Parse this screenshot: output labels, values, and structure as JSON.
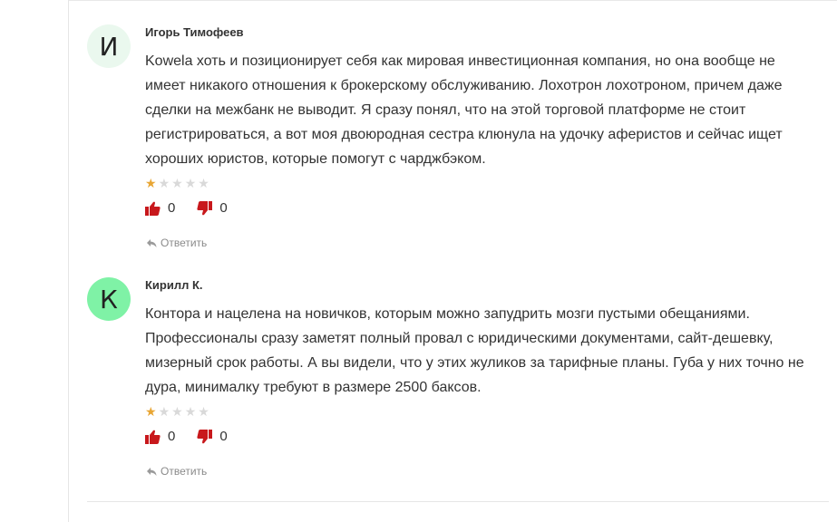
{
  "colors": {
    "avatar_bg_1": "#eaf8ee",
    "avatar_bg_2": "#7ff2a6",
    "star_on": "#e8a634",
    "star_off": "#d9d9d9",
    "thumb": "#c8181c"
  },
  "comments": [
    {
      "avatar_letter": "И",
      "author": "Игорь Тимофеев",
      "text": "Kowela хоть и позиционирует себя как мировая инвестиционная компания, но она вообще не имеет никакого отношения к брокерскому обслуживанию. Лохотрон лохотроном, причем даже сделки на межбанк не выводит. Я сразу понял, что на этой торговой платформе не стоит регистрироваться, а вот моя двоюродная сестра клюнула на удочку аферистов и сейчас ищет хороших юристов, которые помогут с чарджбэком.",
      "rating": 1,
      "rating_max": 5,
      "likes": "0",
      "dislikes": "0",
      "reply_label": "Ответить"
    },
    {
      "avatar_letter": "К",
      "author": "Кирилл К.",
      "text": "Контора и нацелена на новичков, которым можно запудрить мозги пустыми обещаниями. Профессионалы сразу заметят полный провал с юридическими документами, сайт-дешевку, мизерный срок работы. А вы видели, что у этих жуликов за тарифные планы. Губа у них точно не дура, минималку требуют в размере 2500 баксов.",
      "rating": 1,
      "rating_max": 5,
      "likes": "0",
      "dislikes": "0",
      "reply_label": "Ответить"
    }
  ],
  "icons": {
    "like": "thumbs-up-icon",
    "dislike": "thumbs-down-icon",
    "reply": "reply-arrow-icon",
    "star": "star-icon"
  }
}
